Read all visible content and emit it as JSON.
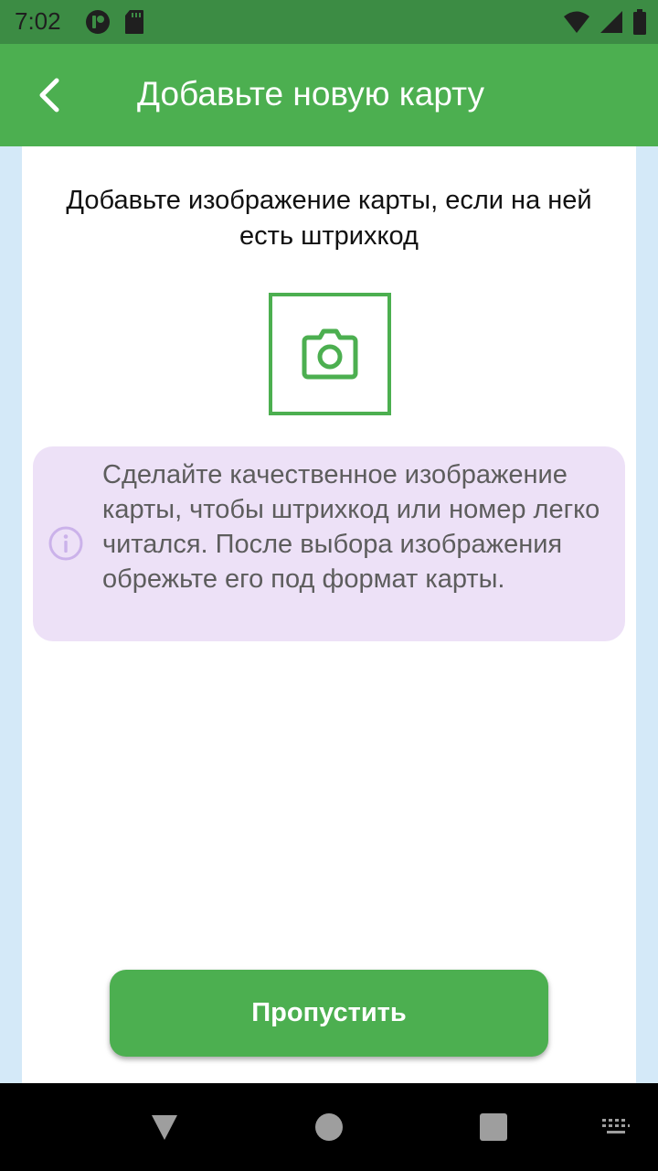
{
  "status_bar": {
    "time": "7:02",
    "left_icons": [
      "app-notification-icon",
      "sd-card-icon"
    ],
    "right_icons": [
      "wifi-icon",
      "cell-signal-icon",
      "battery-icon"
    ]
  },
  "app_bar": {
    "title": "Добавьте новую карту",
    "back_icon": "chevron-left-icon"
  },
  "content": {
    "prompt": "Добавьте изображение карты, если на ней есть штрихкод",
    "camera_icon": "camera-icon",
    "info": {
      "icon": "info-icon",
      "text": "Сделайте качественное изображение карты, чтобы штрихкод или номер легко читался. После выбора изображения обрежьте его под формат карты."
    },
    "skip_button": "Пропустить"
  },
  "colors": {
    "status_bar": "#3c8c44",
    "app_bar": "#4caf50",
    "accent": "#4caf50",
    "info_background": "#ede1f7",
    "info_icon": "#cbb2ea",
    "page_background": "#d4e9f8"
  },
  "nav_bar": {
    "icons": [
      "back-triangle-icon",
      "home-circle-icon",
      "recents-square-icon",
      "keyboard-icon"
    ]
  }
}
